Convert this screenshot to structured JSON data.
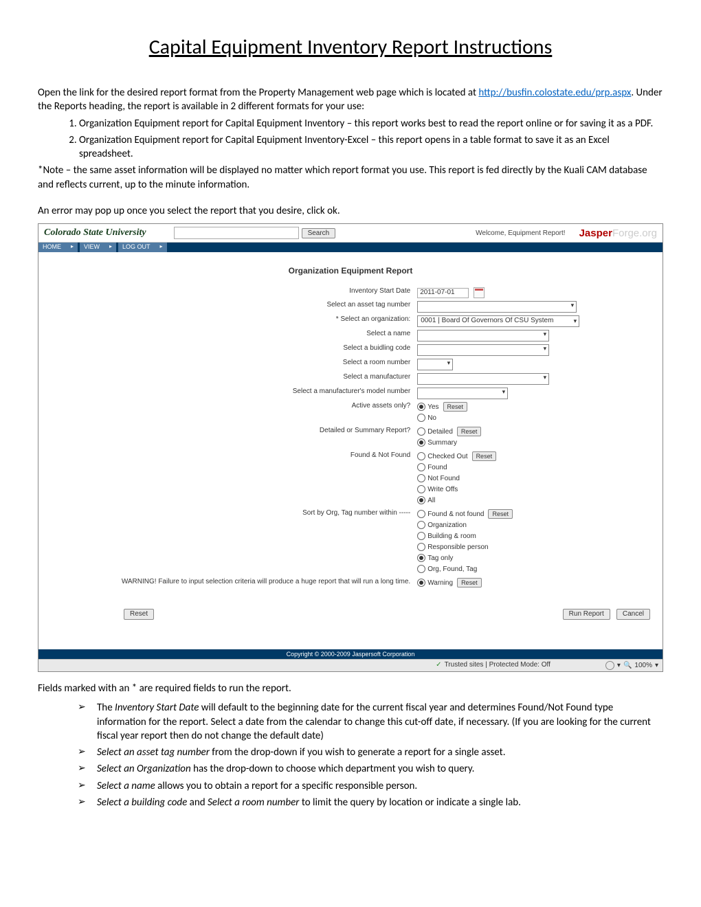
{
  "title": "Capital Equipment Inventory Report Instructions",
  "intro1": "Open the link for the desired report format from the Property Management web page which is located at ",
  "link_text": "http://busfin.colostate.edu/prp.aspx",
  "intro2": ".  Under the Reports heading, the report is available in 2 different formats for your use:",
  "list_items": [
    "Organization Equipment report for Capital Equipment Inventory – this report works best to read the report online or for saving it as a PDF.",
    "Organization Equipment report for Capital Equipment Inventory-Excel – this report opens in a table format to save it as an Excel spreadsheet."
  ],
  "note": "*Note – the same asset information will be displayed no matter which report format you use.  This report is fed directly by the Kuali CAM database and reflects current, up to the minute information.",
  "error_note": "An error may pop up once you select the report that you desire, click ok.",
  "screenshot": {
    "brand": "Colorado State University",
    "search_btn": "Search",
    "welcome": "Welcome, Equipment Report!",
    "jasper1": "Jasper",
    "jasper2": "Forge.org",
    "nav": [
      "HOME",
      "VIEW",
      "LOG OUT"
    ],
    "form_title": "Organization Equipment Report",
    "labels": {
      "start_date": "Inventory Start Date",
      "tag": "Select an asset tag number",
      "org": "* Select an organization:",
      "name": "Select a name",
      "bcode": "Select a buidling code",
      "room": "Select a room number",
      "manu": "Select a manufacturer",
      "model": "Select a manufacturer's model number",
      "active": "Active assets only?",
      "detsum": "Detailed or Summary Report?",
      "found": "Found & Not Found",
      "sort": "Sort by Org, Tag number within -----",
      "warn": "WARNING! Failure to input selection criteria will produce a huge report that will run a long time."
    },
    "values": {
      "start_date": "2011-07-01",
      "org_sel": "0001 | Board Of Governors Of CSU System"
    },
    "opts": {
      "active": [
        "Yes",
        "No"
      ],
      "detsum": [
        "Detailed",
        "Summary"
      ],
      "found": [
        "Checked Out",
        "Found",
        "Not Found",
        "Write Offs",
        "All"
      ],
      "sort": [
        "Found & not found",
        "Organization",
        "Building & room",
        "Responsible person",
        "Tag only",
        "Org, Found, Tag"
      ],
      "warn": [
        "Warning"
      ]
    },
    "btn_reset": "Reset",
    "btn_run": "Run Report",
    "btn_cancel": "Cancel",
    "copyright": "Copyright © 2000-2009 Jaspersoft Corporation",
    "status_mid": "Trusted sites | Protected Mode: Off",
    "zoom": "100%"
  },
  "below_intro": "Fields marked with an * are required fields to run the report.",
  "bullets": [
    {
      "em": "Inventory Start Date",
      "pre": "The ",
      "post": " will default to the beginning date for the current fiscal year and determines Found/Not Found type information for the report. Select a date from the calendar to change this cut-off date, if necessary. (If you are looking for the current fiscal year report then do not change the default date)"
    },
    {
      "em": "Select an asset tag number",
      "pre": "",
      "post": " from the drop-down if you wish to generate a report for a single asset."
    },
    {
      "em": "Select an Organization",
      "pre": "",
      "post": " has the drop-down to choose which department you wish to query."
    },
    {
      "em": "Select a name",
      "pre": "",
      "post": " allows you to obtain a report for a specific responsible person."
    },
    {
      "em": "Select a building code",
      "pre": "",
      "post_and": " and ",
      "em2": "Select a room number",
      "post": " to limit the query by location or indicate a single lab."
    }
  ]
}
